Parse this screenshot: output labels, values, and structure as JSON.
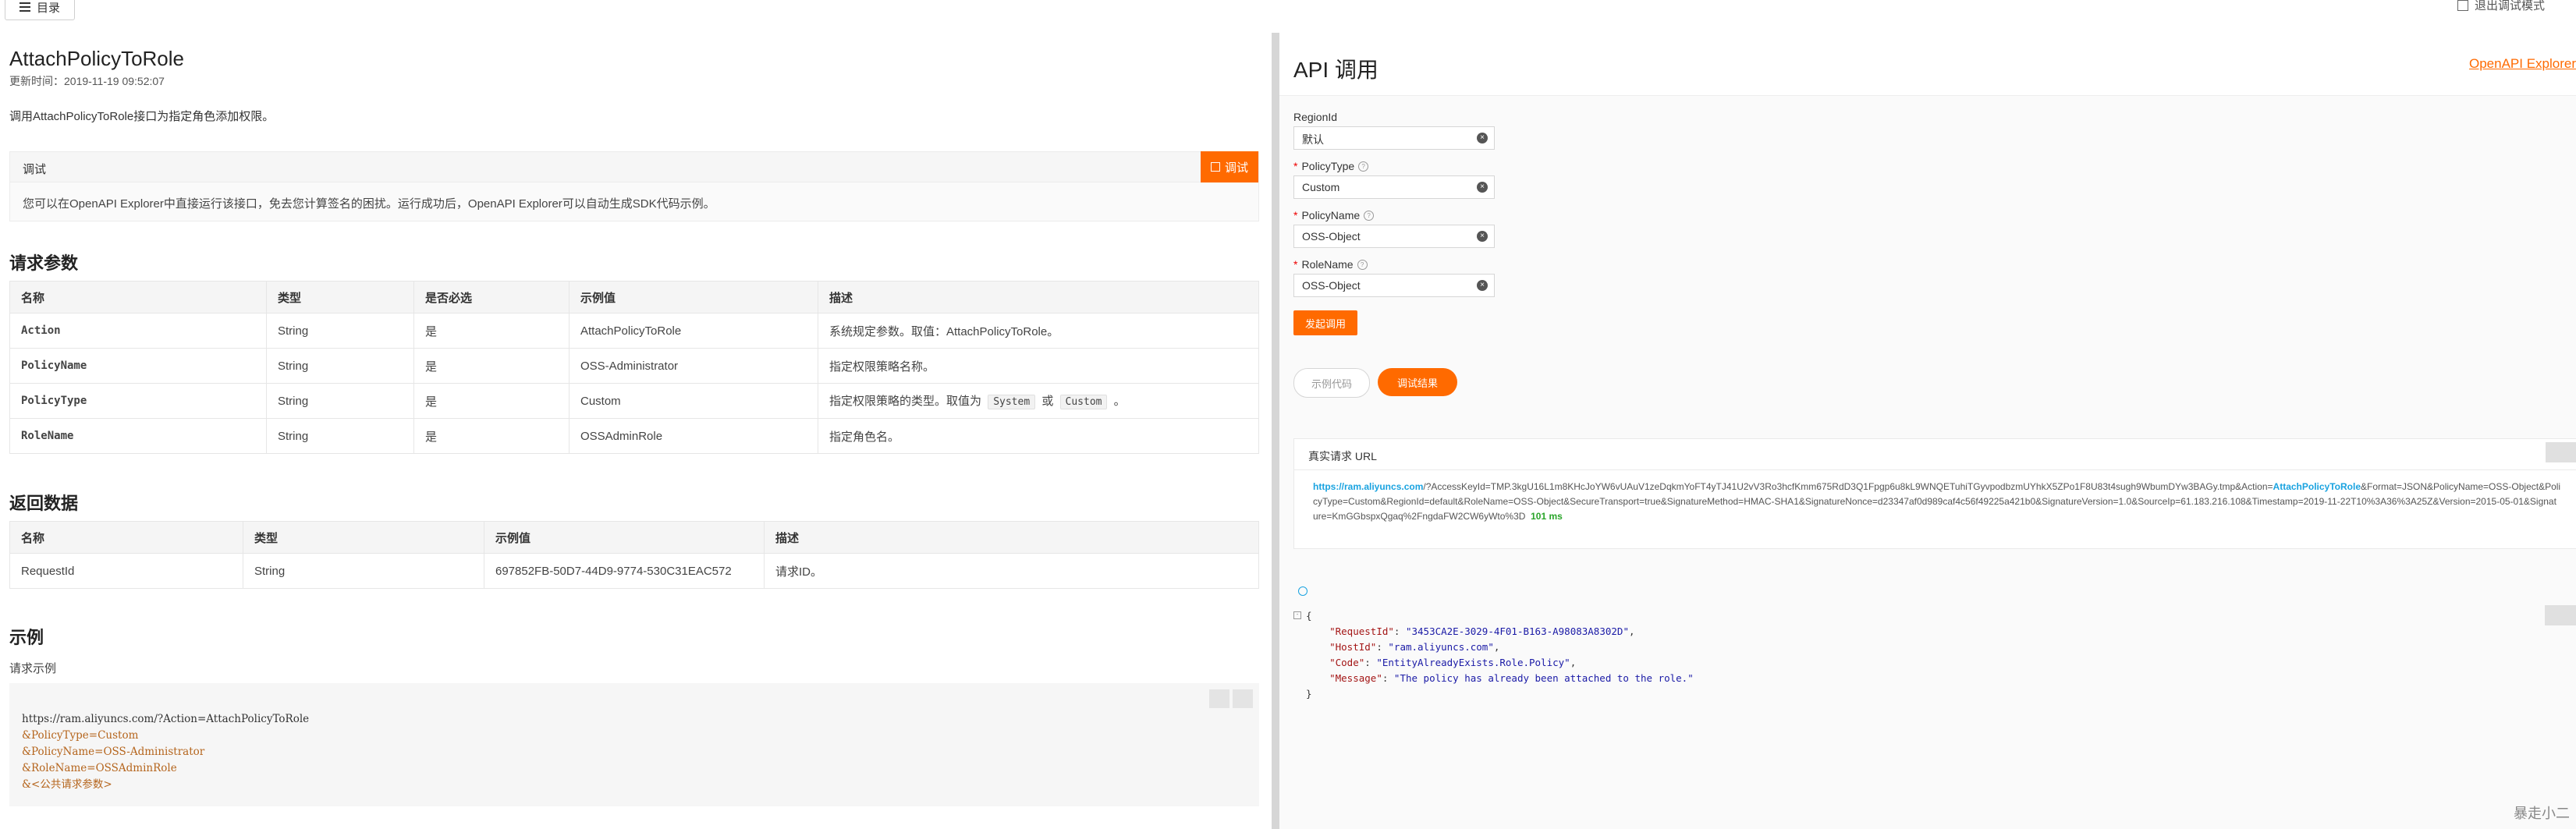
{
  "topbar": {
    "toc_label": "目录",
    "exit_debug_label": "退出调试模式"
  },
  "doc": {
    "title": "AttachPolicyToRole",
    "updated": "更新时间：2019-11-19 09:52:07",
    "description": "调用AttachPolicyToRole接口为指定角色添加权限。",
    "debug_label": "调试",
    "debug_button": "调试",
    "debug_note": "您可以在OpenAPI Explorer中直接运行该接口，免去您计算签名的困扰。运行成功后，OpenAPI Explorer可以自动生成SDK代码示例。",
    "request_params_title": "请求参数",
    "request_params": {
      "headers": [
        "名称",
        "类型",
        "是否必选",
        "示例值",
        "描述"
      ],
      "rows": [
        {
          "name": "Action",
          "type": "String",
          "required": "是",
          "example": "AttachPolicyToRole",
          "desc": "系统规定参数。取值：AttachPolicyToRole。"
        },
        {
          "name": "PolicyName",
          "type": "String",
          "required": "是",
          "example": "OSS-Administrator",
          "desc": "指定权限策略名称。"
        },
        {
          "name": "PolicyType",
          "type": "String",
          "required": "是",
          "example": "Custom",
          "desc": "指定权限策略的类型。取值为",
          "opt1": "System",
          "or": "或",
          "opt2": "Custom",
          "tail": "。"
        },
        {
          "name": "RoleName",
          "type": "String",
          "required": "是",
          "example": "OSSAdminRole",
          "desc": "指定角色名。"
        }
      ]
    },
    "response_title": "返回数据",
    "response": {
      "headers": [
        "名称",
        "类型",
        "示例值",
        "描述"
      ],
      "rows": [
        {
          "name": "RequestId",
          "type": "String",
          "example": "697852FB-50D7-44D9-9774-530C31EAC572",
          "desc": "请求ID。"
        }
      ]
    },
    "example_title": "示例",
    "request_example_label": "请求示例",
    "code_lines": [
      "https://ram.aliyuncs.com/?Action=AttachPolicyToRole",
      "&PolicyType=Custom",
      "&PolicyName=OSS-Administrator",
      "&RoleName=OSSAdminRole",
      "&<公共请求参数>"
    ]
  },
  "api": {
    "title": "API 调用",
    "explorer_link": "OpenAPI Explorer",
    "fields": [
      {
        "label": "RegionId",
        "value": "默认",
        "required": false
      },
      {
        "label": "PolicyType",
        "value": "Custom",
        "required": true
      },
      {
        "label": "PolicyName",
        "value": "OSS-Object",
        "required": true
      },
      {
        "label": "RoleName",
        "value": "OSS-Object",
        "required": true
      }
    ],
    "required_mark": "*",
    "submit_label": "发起调用",
    "tab_sample": "示例代码",
    "tab_result": "调试结果",
    "real_url_label": "真实请求 URL",
    "url_host": "https://ram.aliyuncs.com",
    "url_part1": "/?AccessKeyId=TMP.3kgU16L1m8KHcJoYW6vUAuV1zeDqkmYoFT4yTJ41U2vV3Ro3hcfKmm675RdD3Q1Fpgp6u8kL9WNQETuhiTGyvpodbzmUYhkX5ZPo1F8U83t4sugh9WbumDYw3BAGy.tmp&Action=",
    "url_action": "AttachPolicyToRole",
    "url_part2": "&Format=JSON&PolicyName=OSS-Object&PolicyType=Custom&RegionId=default&RoleName=OSS-Object&SecureTransport=true&SignatureMethod=HMAC-SHA1&SignatureNonce=d23347af0d989caf4c56f49225a421b0&SignatureVersion=1.0&SourceIp=61.183.216.108&Timestamp=2019-11-22T10%3A36%3A25Z&Version=2015-05-01&Signature=KmGGbspxQgaq%2FngdaFW2CW6yWto%3D",
    "url_ms": "101 ms",
    "json": {
      "RequestId": "3453CA2E-3029-4F01-B163-A98083A8302D",
      "HostId": "ram.aliyuncs.com",
      "Code": "EntityAlreadyExists.Role.Policy",
      "Message": "The policy has already been attached to the role."
    }
  },
  "watermark": "暴走小二"
}
